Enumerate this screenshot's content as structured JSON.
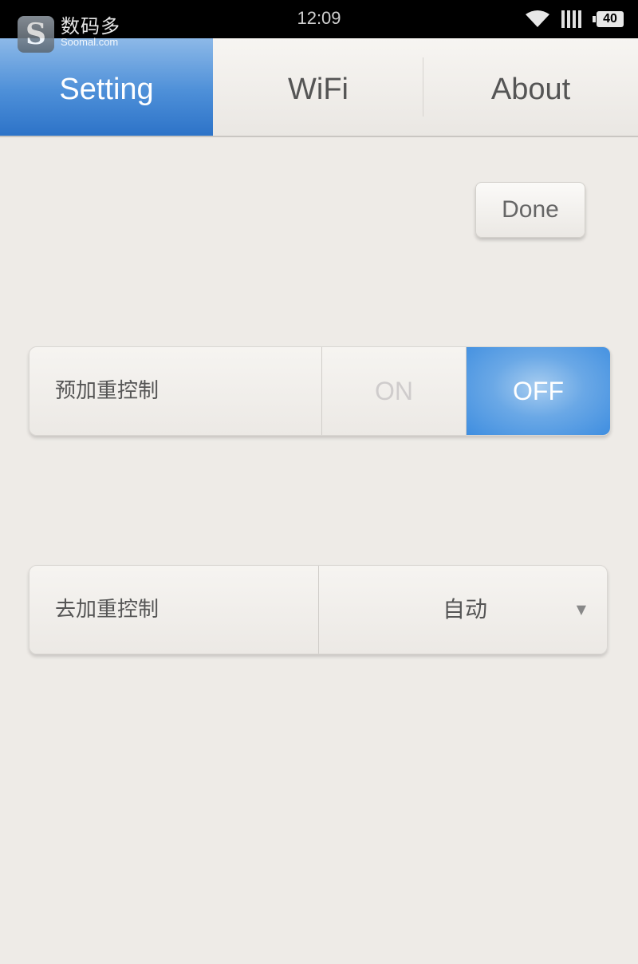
{
  "status_bar": {
    "time": "12:09",
    "battery_level": "40",
    "watermark_cn": "数码多",
    "watermark_en": "Soomal.com",
    "icons": [
      "wifi-icon",
      "signal-icon",
      "battery-icon"
    ]
  },
  "tabs": [
    {
      "label": "Setting",
      "active": true
    },
    {
      "label": "WiFi",
      "active": false
    },
    {
      "label": "About",
      "active": false
    }
  ],
  "done_label": "Done",
  "settings": {
    "pre_emphasis": {
      "label": "预加重控制",
      "on_label": "ON",
      "off_label": "OFF",
      "selected": "OFF"
    },
    "de_emphasis": {
      "label": "去加重控制",
      "value": "自动"
    }
  },
  "colors": {
    "accent": "#4d8fd8",
    "background": "#eeebe7",
    "status_bar": "#000000"
  }
}
